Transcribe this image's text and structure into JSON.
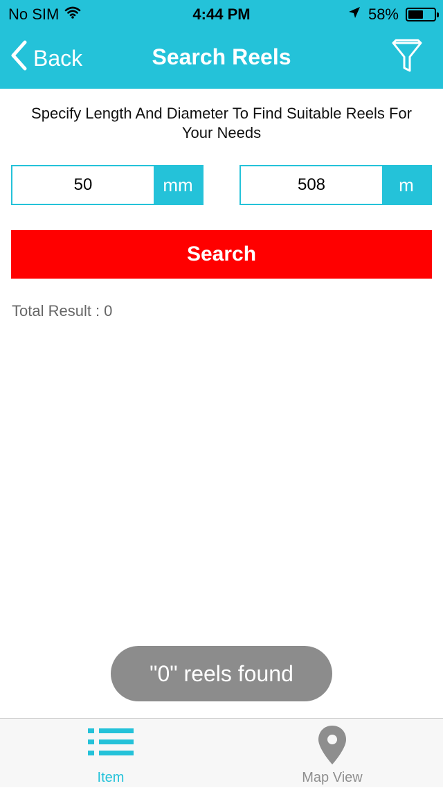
{
  "status_bar": {
    "carrier": "No SIM",
    "time": "4:44 PM",
    "battery_percent": "58%",
    "battery_level": 0.58
  },
  "nav": {
    "back_label": "Back",
    "title": "Search Reels",
    "filter_icon": "filter-icon"
  },
  "instructions": "Specify Length And Diameter To Find Suitable Reels For Your Needs",
  "diameter_field": {
    "value": "50",
    "unit": "mm"
  },
  "length_field": {
    "value": "508",
    "unit": "m"
  },
  "search_button": {
    "label": "Search"
  },
  "result": {
    "label": "Total Result :",
    "count": "0"
  },
  "toast": {
    "text": "\"0\" reels found"
  },
  "tabs": [
    {
      "label": "Item",
      "icon": "list-icon",
      "active": true
    },
    {
      "label": "Map View",
      "icon": "map-pin-icon",
      "active": false
    }
  ],
  "colors": {
    "accent": "#24c2d9",
    "search_button": "#ff0000",
    "toast": "#8c8c8c",
    "inactive_tab": "#8e8e8e"
  }
}
